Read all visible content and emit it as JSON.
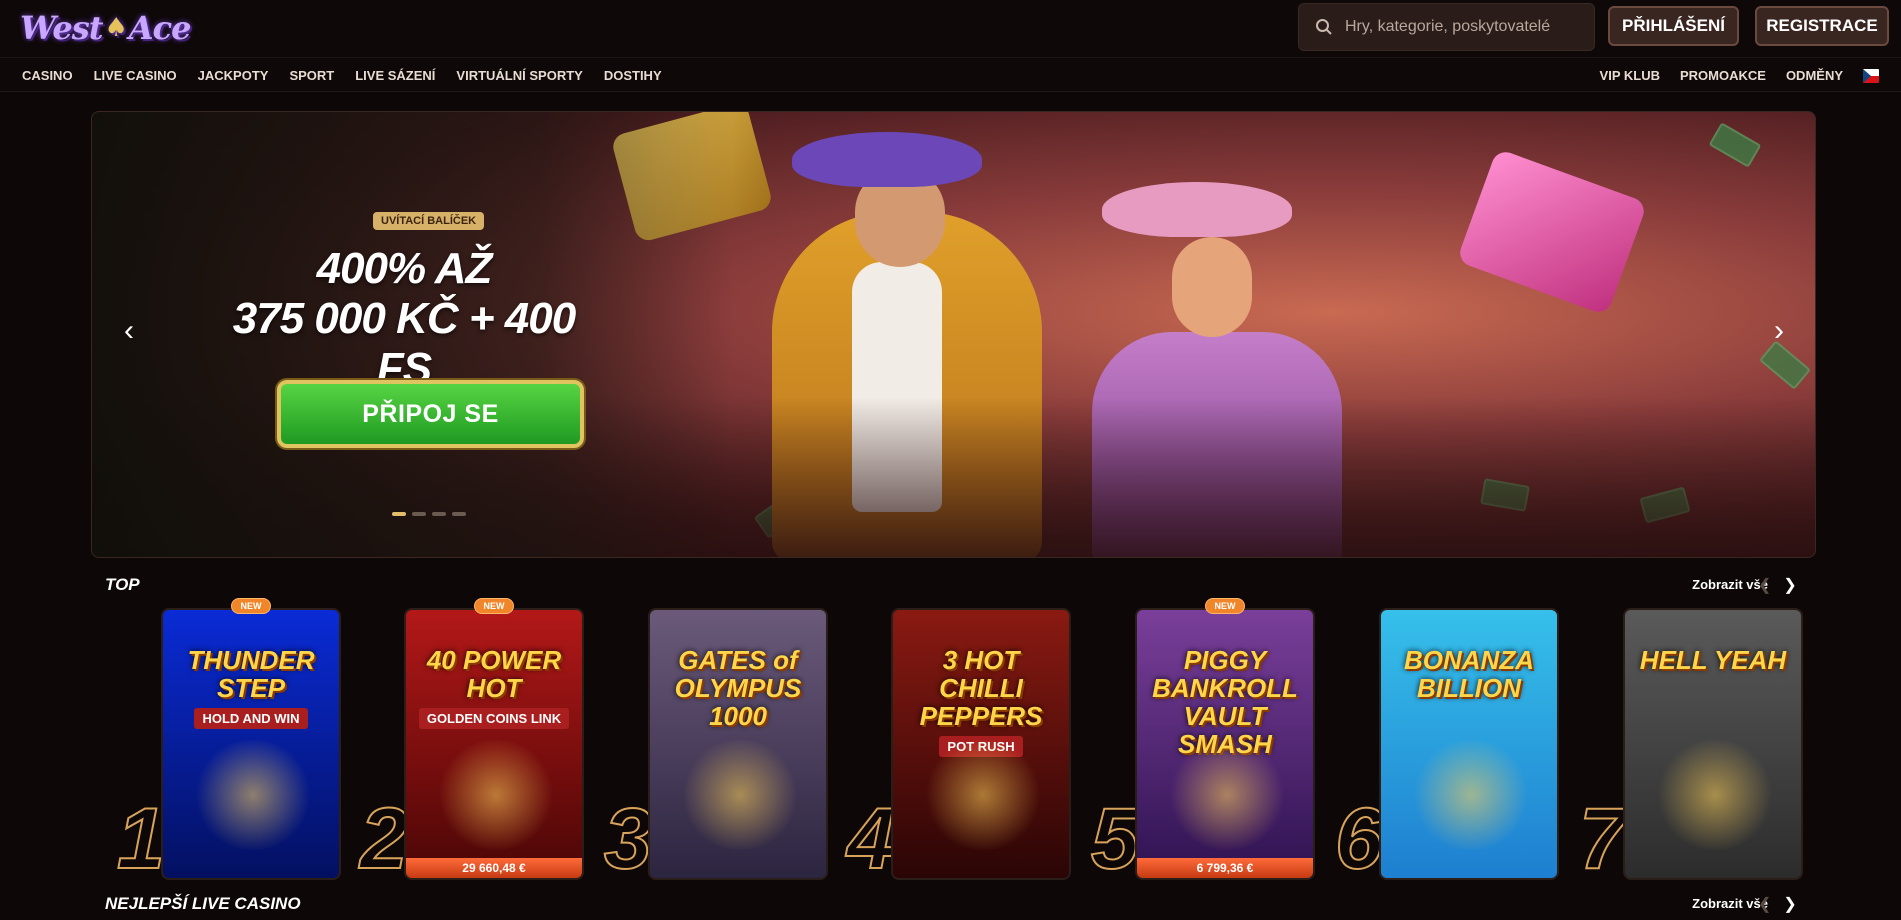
{
  "header": {
    "logo_text_1": "West",
    "logo_text_2": "Ace",
    "search_placeholder": "Hry, kategorie, poskytovatelé",
    "login_label": "PŘIHLÁŠENÍ",
    "register_label": "REGISTRACE"
  },
  "nav": {
    "left": [
      "CASINO",
      "LIVE CASINO",
      "JACKPOTY",
      "SPORT",
      "LIVE SÁZENÍ",
      "VIRTUÁLNÍ SPORTY",
      "DOSTIHY"
    ],
    "right": [
      "VIP KLUB",
      "PROMOAKCE",
      "ODMĚNY"
    ],
    "language": "cs"
  },
  "hero": {
    "badge": "UVÍTACÍ BALÍČEK",
    "title_line1": "400% AŽ",
    "title_line2": "375 000 KČ + 400 FS",
    "cta": "PŘIPOJ SE",
    "slide_count": 4,
    "active_slide": 1
  },
  "sections": {
    "top": {
      "title": "TOP",
      "see_all": "Zobrazit vše"
    },
    "live": {
      "title": "NEJLEPŠÍ LIVE CASINO",
      "see_all": "Zobrazit vše"
    }
  },
  "games": [
    {
      "rank": "1",
      "title": "THUNDER STEP",
      "subtitle": "HOLD AND WIN",
      "badge": "NEW",
      "jackpot": "",
      "bg": "#0a2bd6",
      "bg2": "#031060"
    },
    {
      "rank": "2",
      "title": "40 POWER HOT",
      "subtitle": "GOLDEN COINS LINK",
      "badge": "NEW",
      "jackpot": "29 660,48 €",
      "bg": "#b31818",
      "bg2": "#4a0606"
    },
    {
      "rank": "3",
      "title": "GATES of OLYMPUS 1000",
      "subtitle": "",
      "badge": "",
      "jackpot": "",
      "bg": "#6b5a7a",
      "bg2": "#2c2540"
    },
    {
      "rank": "4",
      "title": "3 HOT CHILLI PEPPERS",
      "subtitle": "POT RUSH",
      "badge": "",
      "jackpot": "",
      "bg": "#8a1a12",
      "bg2": "#2a0505"
    },
    {
      "rank": "5",
      "title": "PIGGY BANKROLL VAULT SMASH",
      "subtitle": "",
      "badge": "NEW",
      "jackpot": "6 799,36 €",
      "bg": "#7a3f9a",
      "bg2": "#2e1250"
    },
    {
      "rank": "6",
      "title": "BONANZA BILLION",
      "subtitle": "",
      "badge": "",
      "jackpot": "",
      "bg": "#36c0ea",
      "bg2": "#1e7fd0"
    },
    {
      "rank": "7",
      "title": "HELL YEAH",
      "subtitle": "",
      "badge": "",
      "jackpot": "",
      "bg": "#5a5a5a",
      "bg2": "#2c2c2c"
    }
  ],
  "colors": {
    "background": "#0d0707",
    "accent_gold": "#d7a35b",
    "cta_green": "#2bbf2b",
    "new_badge": "#f0852a"
  },
  "icons": {
    "search": "search-icon",
    "prev": "chevron-left-icon",
    "next": "chevron-right-icon"
  }
}
